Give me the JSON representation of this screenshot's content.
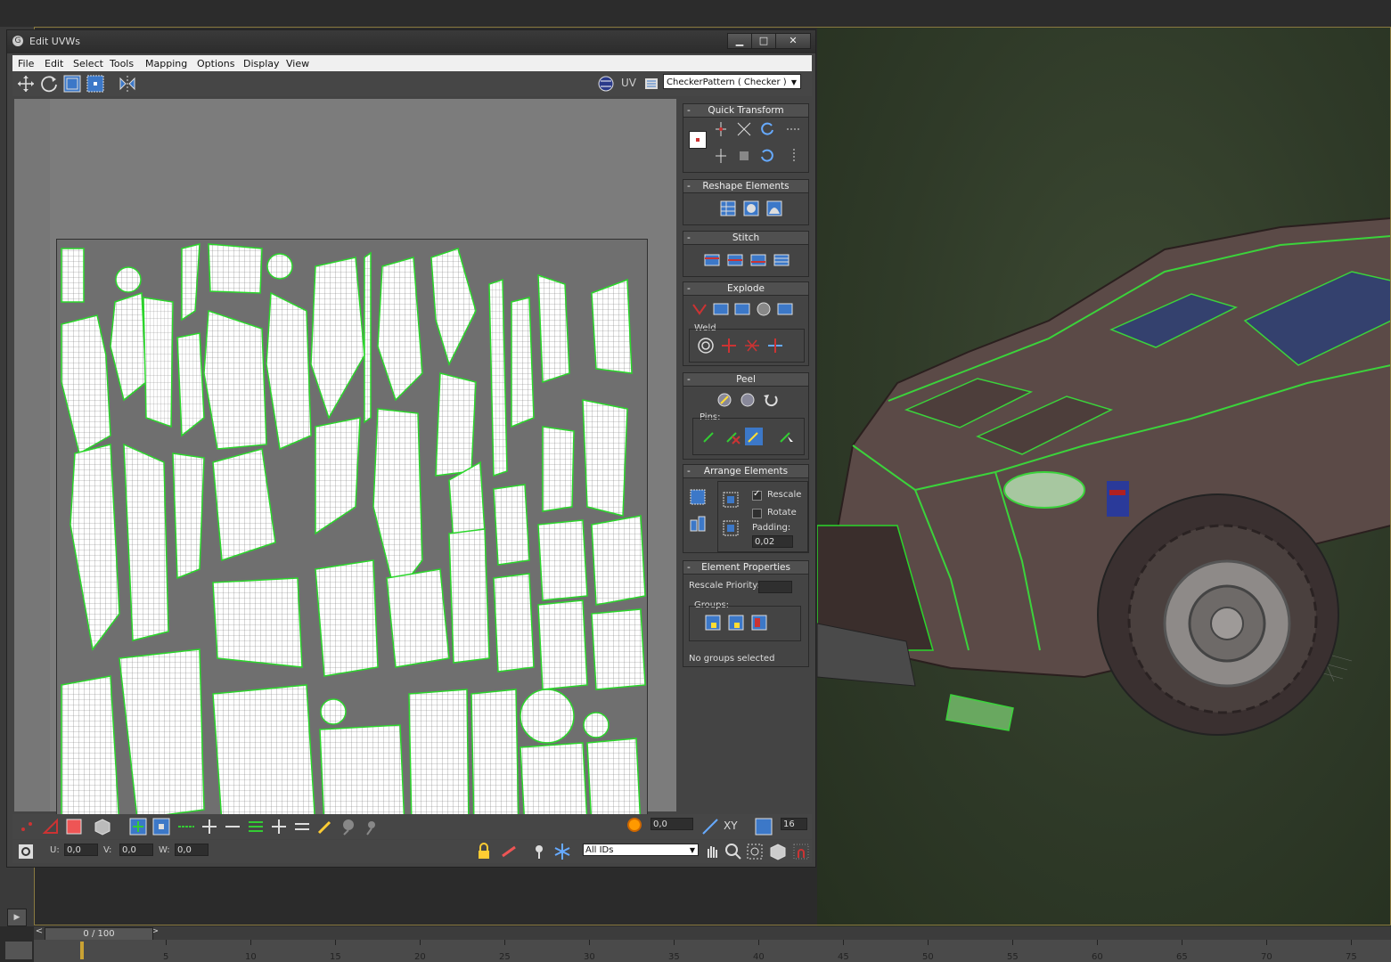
{
  "window": {
    "title": "Edit UVWs",
    "minimize": "▁",
    "maximize": "□",
    "close": "✕"
  },
  "menu": [
    "File",
    "Edit",
    "Select",
    "Tools",
    "Mapping",
    "Options",
    "Display",
    "View"
  ],
  "toolbar": {
    "uv_label": "UV",
    "map_dropdown": "CheckerPattern  ( Checker )"
  },
  "panel": {
    "quick_transform": "Quick Transform",
    "reshape_elements": "Reshape Elements",
    "stitch": "Stitch",
    "explode": "Explode",
    "weld": "Weld",
    "peel": "Peel",
    "pins": "Pins:",
    "arrange_elements": "Arrange Elements",
    "rescale": "Rescale",
    "rescale_checked": true,
    "rotate": "Rotate",
    "rotate_checked": false,
    "padding_label": "Padding:",
    "padding_value": "0,02",
    "element_properties": "Element Properties",
    "rescale_priority": "Rescale Priority:",
    "groups": "Groups:",
    "no_groups": "No groups selected",
    "collapse_symbol": "-"
  },
  "bottom": {
    "soft_value": "0,0",
    "xy_label": "XY",
    "count_value": "16",
    "u_label": "U:",
    "u_value": "0,0",
    "v_label": "V:",
    "v_value": "0,0",
    "w_label": "W:",
    "w_value": "0,0",
    "id_filter": "All IDs"
  },
  "timeline": {
    "frame": "0 / 100",
    "prev": "<",
    "next": ">",
    "ticks": [
      "5",
      "10",
      "15",
      "20",
      "25",
      "30",
      "35",
      "40",
      "45",
      "50",
      "55",
      "60",
      "65",
      "70",
      "75"
    ]
  },
  "colors": {
    "uv_edge": "#2bd62b",
    "uv_wire": "#ffffff",
    "highlight": "#3c78c8"
  }
}
